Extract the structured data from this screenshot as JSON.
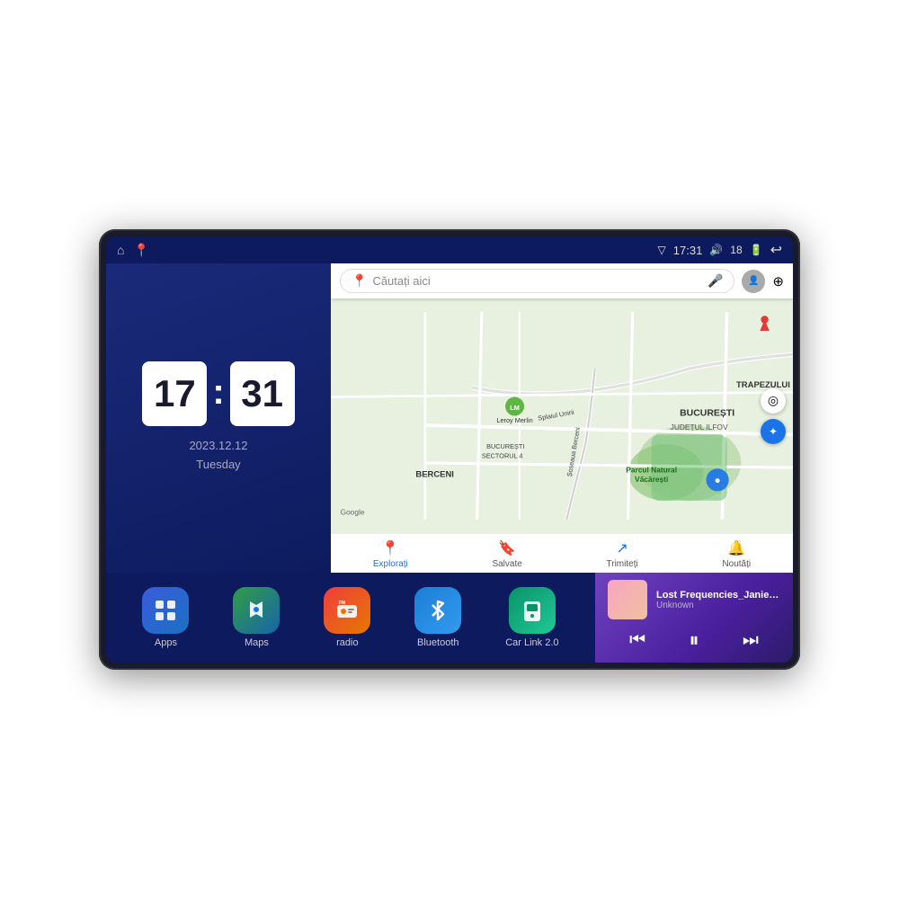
{
  "device": {
    "status_bar": {
      "left_icons": [
        "home",
        "maps"
      ],
      "time": "17:31",
      "signal_icon": "signal",
      "volume_icon": "volume",
      "volume_level": "18",
      "battery_icon": "battery",
      "back_icon": "back"
    },
    "clock": {
      "hour": "17",
      "minute": "31",
      "date": "2023.12.12",
      "day": "Tuesday"
    },
    "map": {
      "search_placeholder": "Căutați aici",
      "locations": [
        "Parcul Natural Văcărești",
        "Leroy Merlin",
        "BUCUREȘTI",
        "JUDEȚUL ILFOV",
        "TRAPEZULUI",
        "BERCENI",
        "BUCUREȘTI SECTORUL 4"
      ],
      "footer_buttons": [
        {
          "icon": "📍",
          "label": "Explorați"
        },
        {
          "icon": "🔖",
          "label": "Salvate"
        },
        {
          "icon": "↗",
          "label": "Trimiteți"
        },
        {
          "icon": "🔔",
          "label": "Noutăți"
        }
      ]
    },
    "apps": [
      {
        "id": "apps",
        "label": "Apps",
        "icon": "⊞",
        "bg_class": "apps-bg"
      },
      {
        "id": "maps",
        "label": "Maps",
        "icon": "🗺",
        "bg_class": "maps-bg"
      },
      {
        "id": "radio",
        "label": "radio",
        "icon": "📻",
        "bg_class": "radio-bg"
      },
      {
        "id": "bluetooth",
        "label": "Bluetooth",
        "icon": "🔵",
        "bg_class": "bt-bg"
      },
      {
        "id": "carlink",
        "label": "Car Link 2.0",
        "icon": "📱",
        "bg_class": "carlink-bg"
      }
    ],
    "music": {
      "title": "Lost Frequencies_Janieck Devy-...",
      "artist": "Unknown",
      "prev_label": "⏮",
      "play_label": "⏸",
      "next_label": "⏭"
    }
  }
}
